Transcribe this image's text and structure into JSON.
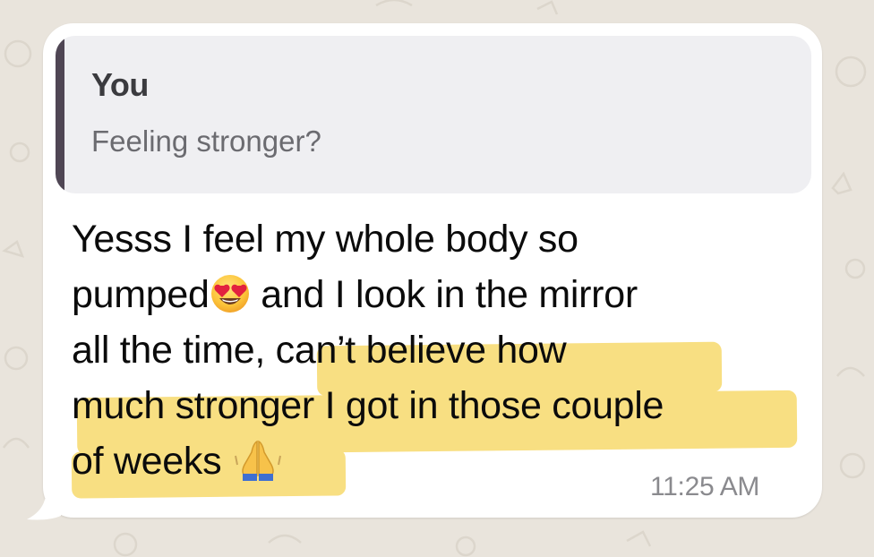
{
  "conversation": {
    "quoted": {
      "author": "You",
      "text": "Feeling stronger?"
    },
    "message": {
      "line1": "Yesss I feel my whole body so",
      "line2_a": "pumped",
      "line2_b": " and I look in the mirror",
      "line3_a": "all the time, ",
      "line3_b": "can’t believe how",
      "line4": "much stronger I got in those couple",
      "line5": "of weeks ",
      "timestamp": "11:25 AM"
    },
    "emojis": {
      "heart_eyes": "heart-eyes-emoji",
      "folded_hands": "folded-hands-emoji"
    },
    "colors": {
      "bubble": "#ffffff",
      "quote_background": "#efeff2",
      "quote_bar": "#4f4654",
      "highlight": "#f8df82",
      "chat_background": "#e9e4dc"
    }
  }
}
